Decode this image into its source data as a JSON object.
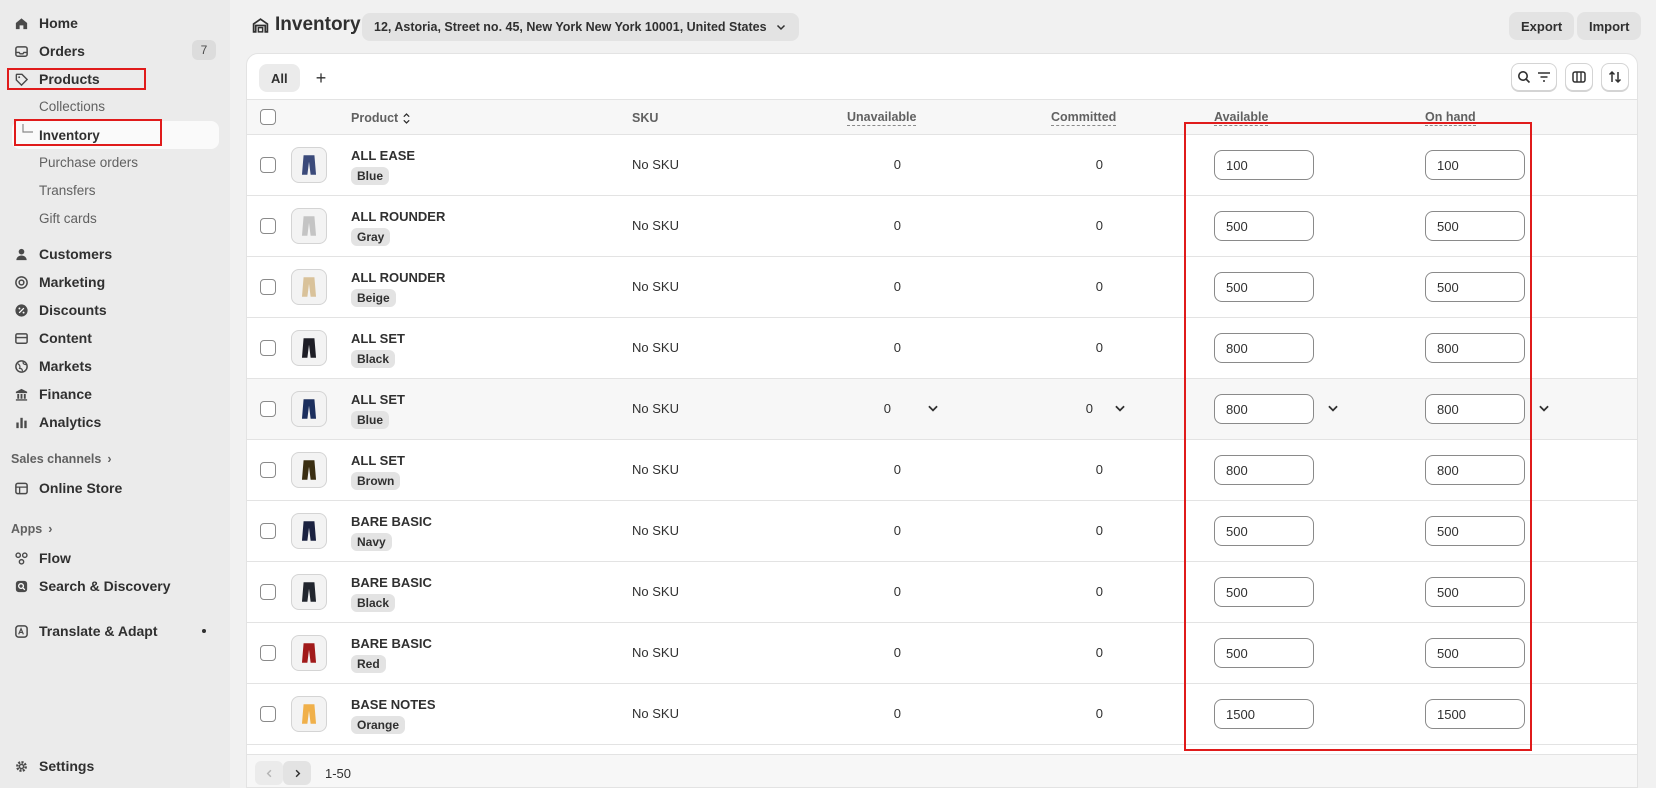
{
  "sidebar": {
    "home": "Home",
    "orders": "Orders",
    "orders_count": "7",
    "products": "Products",
    "collections": "Collections",
    "inventory": "Inventory",
    "purchase_orders": "Purchase orders",
    "transfers": "Transfers",
    "gift_cards": "Gift cards",
    "customers": "Customers",
    "marketing": "Marketing",
    "discounts": "Discounts",
    "content": "Content",
    "markets": "Markets",
    "finance": "Finance",
    "analytics": "Analytics",
    "sales_channels": "Sales channels",
    "online_store": "Online Store",
    "apps": "Apps",
    "flow": "Flow",
    "search_discovery": "Search & Discovery",
    "translate_adapt": "Translate & Adapt",
    "settings": "Settings"
  },
  "header": {
    "title": "Inventory",
    "location": "12, Astoria, Street no. 45, New York New York 10001, United States",
    "export": "Export",
    "import": "Import"
  },
  "tabs": {
    "all": "All",
    "add": "+"
  },
  "table": {
    "columns": {
      "product": "Product",
      "sku": "SKU",
      "unavailable": "Unavailable",
      "committed": "Committed",
      "available": "Available",
      "on_hand": "On hand"
    },
    "rows": [
      {
        "name": "ALL EASE",
        "variant": "Blue",
        "sku": "No SKU",
        "unavailable": "0",
        "committed": "0",
        "available": "100",
        "on_hand": "100",
        "color": "#3b4a7a"
      },
      {
        "name": "ALL ROUNDER",
        "variant": "Gray",
        "sku": "No SKU",
        "unavailable": "0",
        "committed": "0",
        "available": "500",
        "on_hand": "500",
        "color": "#c4c4c4"
      },
      {
        "name": "ALL ROUNDER",
        "variant": "Beige",
        "sku": "No SKU",
        "unavailable": "0",
        "committed": "0",
        "available": "500",
        "on_hand": "500",
        "color": "#d9c29a"
      },
      {
        "name": "ALL SET",
        "variant": "Black",
        "sku": "No SKU",
        "unavailable": "0",
        "committed": "0",
        "available": "800",
        "on_hand": "800",
        "color": "#1e1e26"
      },
      {
        "name": "ALL SET",
        "variant": "Blue",
        "sku": "No SKU",
        "unavailable": "0",
        "committed": "0",
        "available": "800",
        "on_hand": "800",
        "color": "#1c2f5e"
      },
      {
        "name": "ALL SET",
        "variant": "Brown",
        "sku": "No SKU",
        "unavailable": "0",
        "committed": "0",
        "available": "800",
        "on_hand": "800",
        "color": "#3a2e12"
      },
      {
        "name": "BARE BASIC",
        "variant": "Navy",
        "sku": "No SKU",
        "unavailable": "0",
        "committed": "0",
        "available": "500",
        "on_hand": "500",
        "color": "#1b2240"
      },
      {
        "name": "BARE BASIC",
        "variant": "Black",
        "sku": "No SKU",
        "unavailable": "0",
        "committed": "0",
        "available": "500",
        "on_hand": "500",
        "color": "#22262e"
      },
      {
        "name": "BARE BASIC",
        "variant": "Red",
        "sku": "No SKU",
        "unavailable": "0",
        "committed": "0",
        "available": "500",
        "on_hand": "500",
        "color": "#a11a1a"
      },
      {
        "name": "BASE NOTES",
        "variant": "Orange",
        "sku": "No SKU",
        "unavailable": "0",
        "committed": "0",
        "available": "1500",
        "on_hand": "1500",
        "color": "#f0b04a"
      }
    ]
  },
  "pagination": {
    "range": "1-50"
  }
}
